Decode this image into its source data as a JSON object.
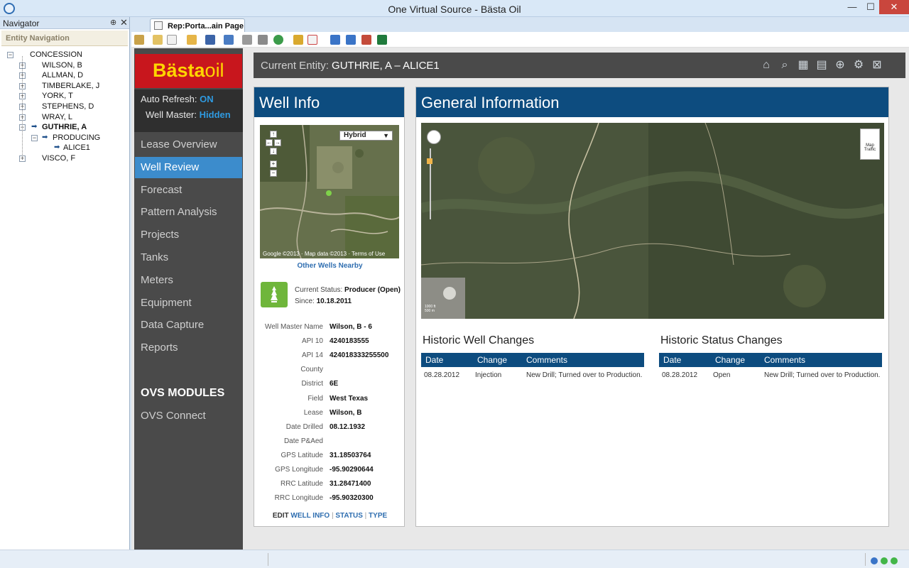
{
  "window": {
    "title": "One Virtual Source - Bästa Oil",
    "minimize": "—",
    "maximize": "☐",
    "close": "✕"
  },
  "navigator": {
    "title": "Navigator",
    "pin": "⊕",
    "close": "✕",
    "section": "Entity Navigation",
    "tree": [
      {
        "label": "CONCESSION",
        "depth": 0,
        "expander": "−"
      },
      {
        "label": "WILSON, B",
        "depth": 1,
        "expander": "+"
      },
      {
        "label": "ALLMAN, D",
        "depth": 1,
        "expander": "+"
      },
      {
        "label": "TIMBERLAKE, J",
        "depth": 1,
        "expander": "+"
      },
      {
        "label": "YORK, T",
        "depth": 1,
        "expander": "+"
      },
      {
        "label": "STEPHENS, D",
        "depth": 1,
        "expander": "+"
      },
      {
        "label": "WRAY, L",
        "depth": 1,
        "expander": "+"
      },
      {
        "label": "GUTHRIE, A",
        "depth": 1,
        "expander": "−",
        "arrow": true,
        "bold": true
      },
      {
        "label": "PRODUCING",
        "depth": 2,
        "expander": "−",
        "arrow": true
      },
      {
        "label": "ALICE1",
        "depth": 3,
        "arrow": true
      },
      {
        "label": "VISCO, F",
        "depth": 1,
        "expander": "+"
      }
    ]
  },
  "doc_tab": {
    "label": "Rep:Porta...ain Page"
  },
  "brand": {
    "name_bold": "Bästa",
    "name_light": "oil",
    "accent": "#c8161d"
  },
  "refresh": {
    "auto_label": "Auto Refresh:",
    "auto_value": "ON",
    "master_label": "Well Master:",
    "master_value": "Hidden"
  },
  "menu": {
    "items": [
      "Lease Overview",
      "Well Review",
      "Forecast",
      "Pattern Analysis",
      "Projects",
      "Tanks",
      "Meters",
      "Equipment",
      "Data Capture",
      "Reports"
    ],
    "active": "Well Review",
    "modules_title": "OVS MODULES",
    "modules_link": "OVS Connect"
  },
  "entity": {
    "label": "Current Entity:",
    "value": "GUTHRIE, A – ALICE1",
    "icons": [
      "home-icon",
      "search-icon",
      "calendar-icon",
      "layout-icon",
      "zoom-icon",
      "settings-icon",
      "close-box-icon"
    ]
  },
  "well_info": {
    "title": "Well Info",
    "map_type": "Hybrid",
    "map_credit": "Google  ©2013 · Map data ©2013 · Terms of Use",
    "other_wells": "Other Wells Nearby",
    "status_label": "Current Status:",
    "status_value": "Producer (Open)",
    "since_label": "Since:",
    "since_value": "10.18.2011",
    "fields": [
      {
        "label": "Well Master Name",
        "value": "Wilson, B - 6"
      },
      {
        "label": "API 10",
        "value": "4240183555"
      },
      {
        "label": "API 14",
        "value": "424018333255500"
      },
      {
        "label": "County",
        "value": ""
      },
      {
        "label": "District",
        "value": "6E"
      },
      {
        "label": "Field",
        "value": "West Texas"
      },
      {
        "label": "Lease",
        "value": "Wilson, B"
      },
      {
        "label": "Date Drilled",
        "value": "08.12.1932"
      },
      {
        "label": "Date P&Aed",
        "value": ""
      },
      {
        "label": "GPS Latitude",
        "value": "31.18503764"
      },
      {
        "label": "GPS Longitude",
        "value": "-95.90290644"
      },
      {
        "label": "RRC Latitude",
        "value": "31.28471400"
      },
      {
        "label": "RRC Longitude",
        "value": "-95.90320300"
      }
    ],
    "edit": {
      "prefix": "EDIT",
      "links": [
        "WELL INFO",
        "STATUS",
        "TYPE"
      ],
      "sep": "|"
    }
  },
  "general_info": {
    "title": "General Information",
    "map_labels": {
      "map": "Map",
      "traffic": "Traffic",
      "scale1": "1000 ft",
      "scale2": "500 m"
    },
    "historic_well": {
      "title": "Historic Well Changes",
      "columns": [
        "Date",
        "Change",
        "Comments"
      ],
      "rows": [
        [
          "08.28.2012",
          "Injection",
          "New Drill; Turned over to Production."
        ]
      ]
    },
    "historic_status": {
      "title": "Historic Status Changes",
      "columns": [
        "Date",
        "Change",
        "Comments"
      ],
      "rows": [
        [
          "08.28.2012",
          "Open",
          "New Drill; Turned over to Production."
        ]
      ]
    }
  }
}
